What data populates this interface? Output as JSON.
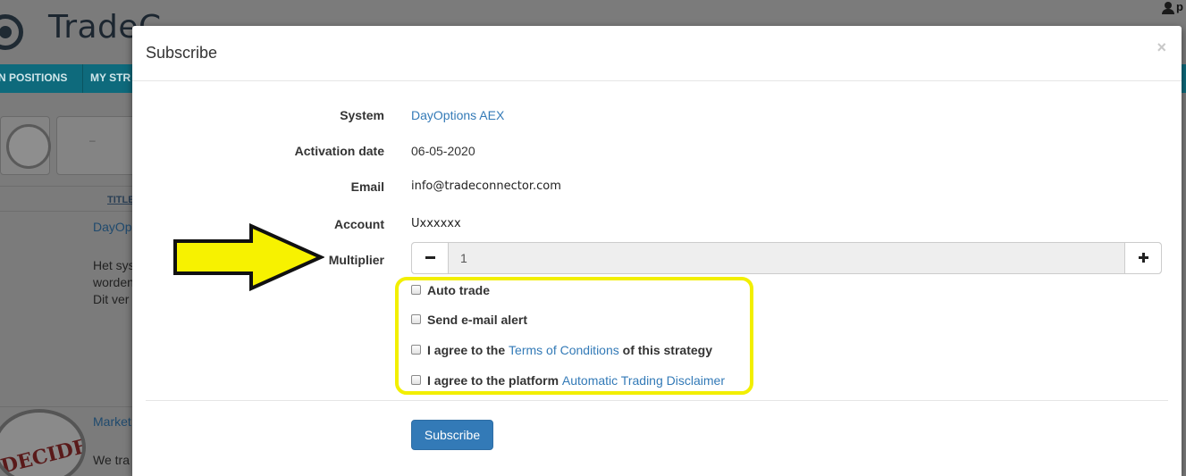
{
  "background": {
    "logo_text": "TradeC",
    "user_label": "p",
    "nav": [
      "N POSITIONS",
      "MY STR"
    ],
    "dash": "–",
    "column_title": "TITLE",
    "rows": [
      {
        "title": "DayOp",
        "lines": [
          "Het sys",
          "worden",
          "Dit ver"
        ]
      },
      {
        "title": "Market",
        "lines": [
          "We tra"
        ]
      }
    ],
    "clock_text": "DECIDE"
  },
  "modal": {
    "title": "Subscribe",
    "close": "×",
    "fields": {
      "system_label": "System",
      "system_value": "DayOptions AEX",
      "activation_label": "Activation date",
      "activation_value": "06-05-2020",
      "email_label": "Email",
      "email_value": "info@tradeconnector.com",
      "account_label": "Account",
      "account_value": "Uxxxxxx",
      "multiplier_label": "Multiplier",
      "multiplier_value": "1"
    },
    "checkboxes": {
      "auto_trade": "Auto trade",
      "email_alert": "Send e-mail alert",
      "terms_prefix": "I agree to the ",
      "terms_link": "Terms of Conditions",
      "terms_suffix": " of this strategy",
      "disclaimer_prefix": "I agree to the platform ",
      "disclaimer_link": "Automatic Trading Disclaimer"
    },
    "submit_label": "Subscribe"
  },
  "colors": {
    "link": "#337ab7",
    "primary_button": "#337ab7",
    "nav_bar": "#0e6a7c",
    "annotation": "#f2ef00"
  },
  "icons": [
    "user-icon",
    "close-icon",
    "minus-icon",
    "plus-icon",
    "arrow-annotation-icon"
  ]
}
